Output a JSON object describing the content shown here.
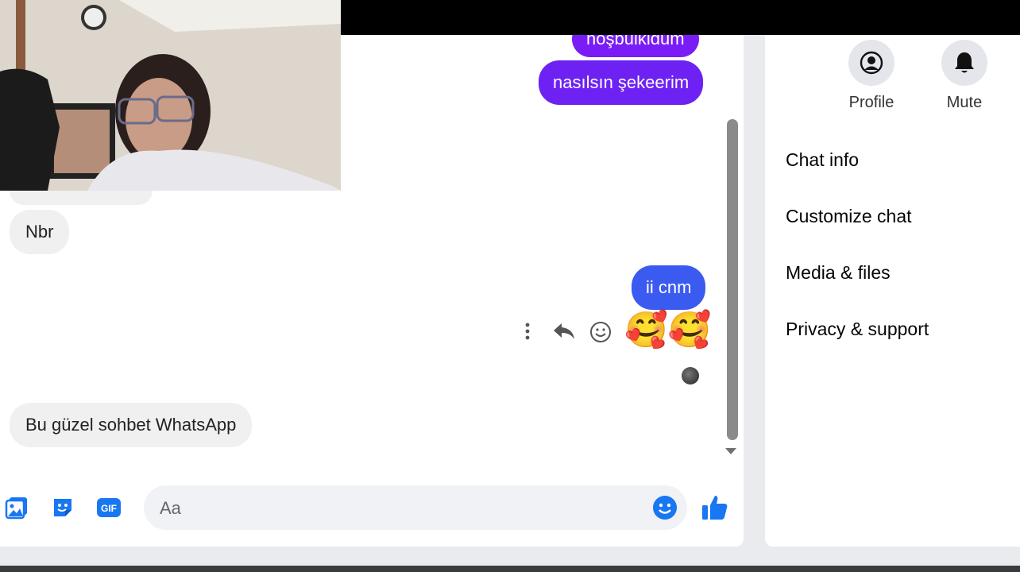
{
  "chat": {
    "messages": [
      {
        "id": "m1",
        "dir": "out",
        "text": "hoşbulkldum"
      },
      {
        "id": "m2",
        "dir": "out",
        "text": "nasılsın şekeerim"
      },
      {
        "id": "m3",
        "dir": "in",
        "text": "Nbr"
      },
      {
        "id": "m4",
        "dir": "out",
        "text": "ii cnm"
      },
      {
        "id": "m5",
        "dir": "in",
        "text": "Bu güzel sohbet WhatsApp"
      }
    ],
    "reaction_emojis": "🥰🥰",
    "colors": {
      "outgoing_top": "#7a1cf6",
      "outgoing_bottom": "#3b5bf0",
      "incoming": "#f0f0f0",
      "accent": "#1877f2"
    }
  },
  "message_actions": {
    "icons": [
      "more-vertical-icon",
      "reply-icon",
      "emoji-react-icon"
    ]
  },
  "composer": {
    "placeholder": "Aa",
    "icons": [
      "photo-icon",
      "sticker-icon",
      "gif-icon",
      "emoji-icon",
      "like-icon"
    ]
  },
  "sidebar": {
    "buttons": [
      {
        "id": "profile",
        "label": "Profile",
        "icon": "profile-icon"
      },
      {
        "id": "mute",
        "label": "Mute",
        "icon": "bell-icon"
      }
    ],
    "items": [
      {
        "label": "Chat info"
      },
      {
        "label": "Customize chat"
      },
      {
        "label": "Media & files"
      },
      {
        "label": "Privacy & support"
      }
    ]
  },
  "webcam": {
    "icon": "webcam-overlay"
  }
}
